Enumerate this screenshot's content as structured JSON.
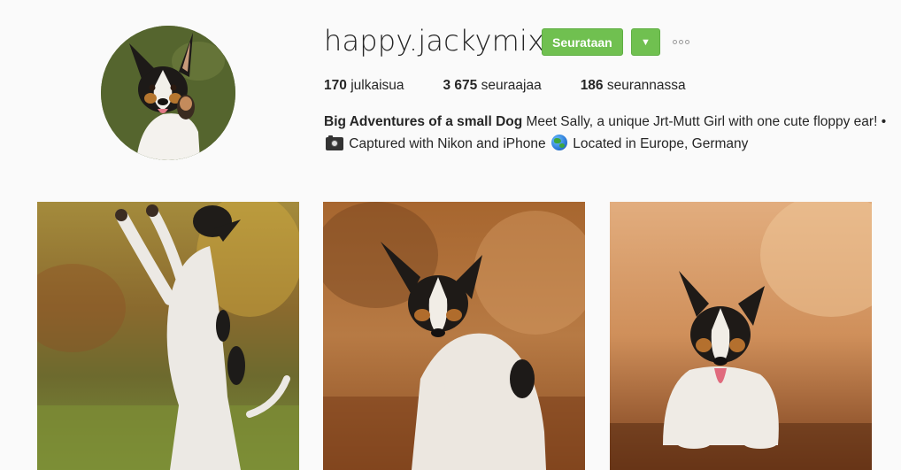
{
  "profile": {
    "username": "happy.jackymix",
    "avatar_icon": "dog-avatar"
  },
  "actions": {
    "follow_label": "Seurataan",
    "dropdown_icon": "▼",
    "more_icon": "ellipsis-icon",
    "accent_color": "#70c050"
  },
  "stats": {
    "posts_count": "170",
    "posts_label": "julkaisua",
    "followers_count": "3 675",
    "followers_label": "seuraajaa",
    "following_count": "186",
    "following_label": "seurannassa"
  },
  "bio": {
    "name": "Big Adventures of a small Dog",
    "text_part1": " Meet Sally, a unique Jrt-Mutt Girl with one cute floppy ear! • ",
    "camera_icon": "camera-icon",
    "text_part2": " Captured with Nikon and iPhone ",
    "globe_icon": "globe-icon",
    "text_part3": " Located in Europe, Germany"
  },
  "posts": [
    {
      "image": "dog-jumping-photo"
    },
    {
      "image": "dog-sitting-paw-raised-photo"
    },
    {
      "image": "dog-lying-in-leaves-photo"
    }
  ]
}
